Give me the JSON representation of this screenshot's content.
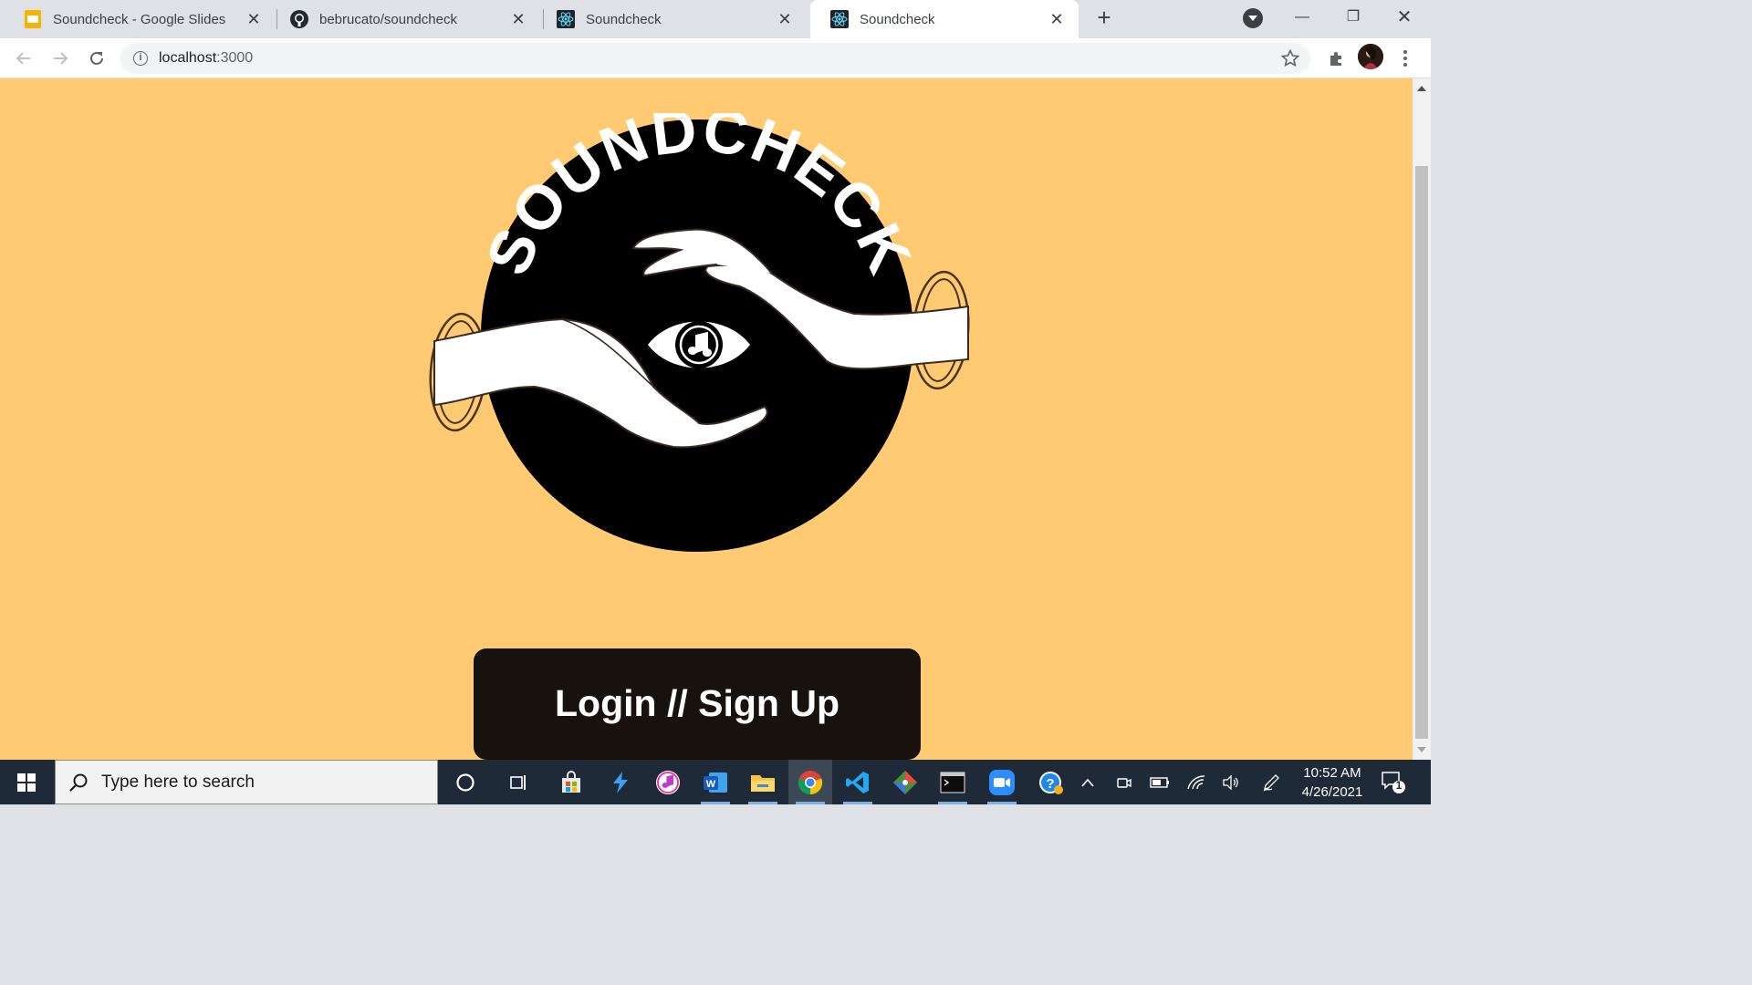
{
  "browser": {
    "tabs": [
      {
        "title": "Soundcheck - Google Slides",
        "favicon": "google-slides-icon",
        "active": false
      },
      {
        "title": "bebrucato/soundcheck",
        "favicon": "github-icon",
        "active": false
      },
      {
        "title": "Soundcheck",
        "favicon": "react-icon",
        "active": false
      },
      {
        "title": "Soundcheck",
        "favicon": "react-icon",
        "active": true
      }
    ],
    "url_host": "localhost",
    "url_port": ":3000"
  },
  "page": {
    "background": "#ffca72",
    "logo_text": "SOUNDCHECK",
    "login_label": "Login // Sign Up"
  },
  "taskbar": {
    "search_placeholder": "Type here to search",
    "time": "10:52 AM",
    "date": "4/26/2021",
    "notification_count": "1"
  }
}
